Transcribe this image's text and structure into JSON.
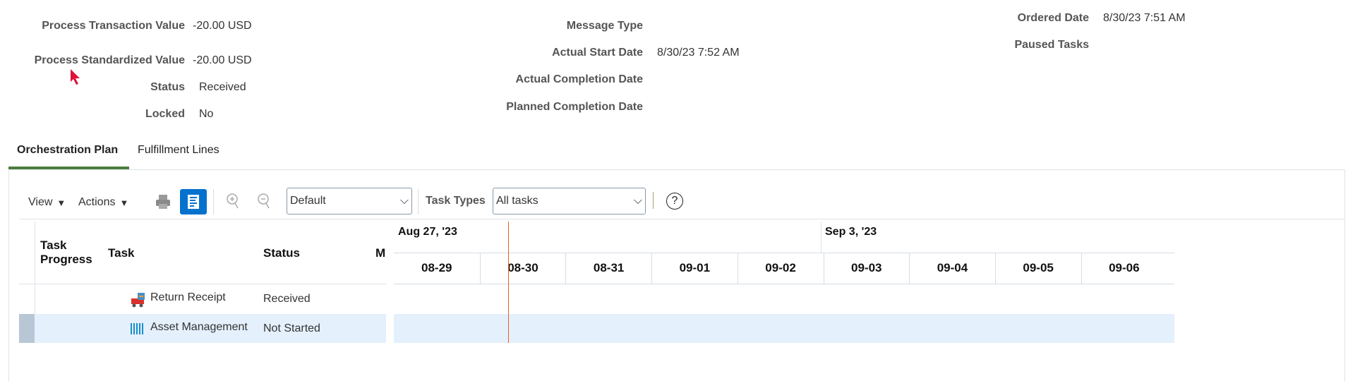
{
  "summary": {
    "col1": [
      {
        "label": "Process Transaction Value",
        "value": "-20.00 USD"
      },
      {
        "label": "Process Standardized Value",
        "value": "-20.00 USD"
      },
      {
        "label": "Status",
        "value": "Received"
      },
      {
        "label": "Locked",
        "value": "No"
      }
    ],
    "col2": [
      {
        "label": "Message Type",
        "value": ""
      },
      {
        "label": "Actual Start Date",
        "value": "8/30/23 7:52 AM"
      },
      {
        "label": "Actual Completion Date",
        "value": ""
      },
      {
        "label": "Planned Completion Date",
        "value": ""
      }
    ],
    "col3": [
      {
        "label": "Ordered Date",
        "value": "8/30/23 7:51 AM"
      },
      {
        "label": "Paused Tasks",
        "value": ""
      }
    ]
  },
  "tabs": [
    {
      "label": "Orchestration Plan",
      "active": true
    },
    {
      "label": "Fulfillment Lines",
      "active": false
    }
  ],
  "toolbar": {
    "view": "View",
    "actions": "Actions",
    "zoom_select": "Default",
    "task_types_label": "Task Types",
    "task_types_select": "All tasks"
  },
  "table": {
    "headers": {
      "progress": "Task Progress",
      "task": "Task",
      "status": "Status",
      "more": "M"
    },
    "rows": [
      {
        "task": "Return Receipt",
        "status": "Received",
        "icon": "truck-icon"
      },
      {
        "task": "Asset Management",
        "status": "Not Started",
        "icon": "barcode-icon",
        "selected": true
      }
    ]
  },
  "gantt": {
    "weeks": [
      "Aug 27, '23",
      "Sep 3, '23"
    ],
    "days": [
      "08-29",
      "08-30",
      "08-31",
      "09-01",
      "09-02",
      "09-03",
      "09-04",
      "09-05",
      "09-06"
    ]
  },
  "colors": {
    "accent": "#0572ce",
    "today_line": "#f05a28",
    "selected_row": "#e4f0fc",
    "tab_underline": "#4b7e3e"
  }
}
